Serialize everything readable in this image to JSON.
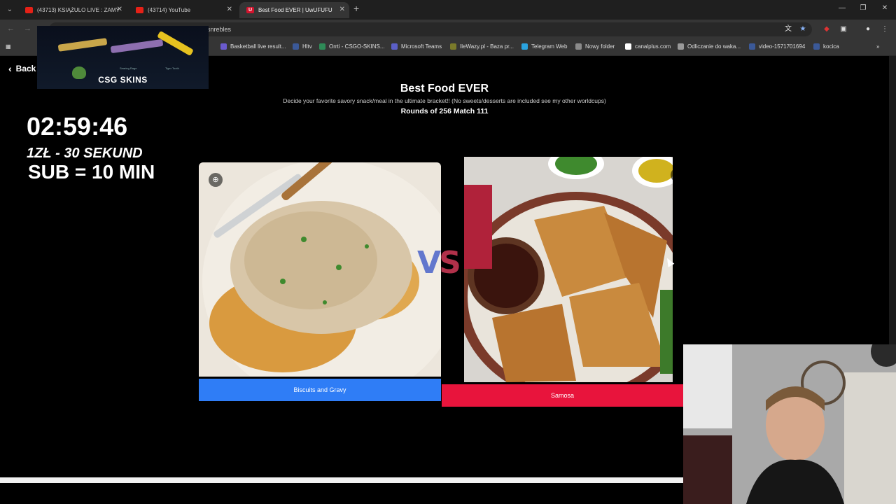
{
  "browser": {
    "tabs": [
      {
        "title": "(43713) KSIĄŻULO LIVE : ZAMY",
        "favicon": "youtube-icon",
        "active": false
      },
      {
        "title": "(43714) YouTube",
        "favicon": "youtube-icon",
        "active": false
      },
      {
        "title": "Best Food EVER | UwUFUFU",
        "favicon": "uwufufu-icon",
        "active": true
      }
    ],
    "address_fragment": "snrebles",
    "bookmarks": [
      {
        "label": "Basketball live result...",
        "color": "#6a5acd"
      },
      {
        "label": "Hltv",
        "color": "#3b5998"
      },
      {
        "label": "Orrti - CSGO-SKINS...",
        "color": "#2e8b57"
      },
      {
        "label": "Microsoft Teams",
        "color": "#5b5fc7"
      },
      {
        "label": "IleWazy.pl - Baza pr...",
        "color": "#7a7a2a"
      },
      {
        "label": "Telegram Web",
        "color": "#2aa3df"
      },
      {
        "label": "Nowy folder",
        "color": "#8a8a8a"
      },
      {
        "label": "canalplus.com",
        "color": "#ffffff"
      },
      {
        "label": "Odliczanie do waka...",
        "color": "#999999"
      },
      {
        "label": "video-1571701694",
        "color": "#3b5998"
      },
      {
        "label": "kocica",
        "color": "#3b5998"
      }
    ]
  },
  "overlay": {
    "banner_logo": "CSG SKINS",
    "banner_captions": [
      "Searing Rage",
      "Tiger Tooth"
    ],
    "timer": "02:59:46",
    "line1": "1ZŁ - 30 SEKUND",
    "line2": "SUB = 10 MIN"
  },
  "page": {
    "back_label": "Back",
    "title": "Best Food EVER",
    "description": "Decide your favorite savory snack/meal in the ultimate bracket!! (No sweets/desserts are included see my other worldcups)",
    "rounds": "Rounds of 256 Match 111",
    "vs_v": "V",
    "vs_s": "S",
    "left_choice": {
      "label": "Biscuits and Gravy",
      "color": "#2f7df6"
    },
    "right_choice": {
      "label": "Samosa",
      "color": "#e8143c"
    }
  },
  "icons": {
    "zoom": "zoom-in-icon",
    "back": "chevron-left-icon"
  }
}
